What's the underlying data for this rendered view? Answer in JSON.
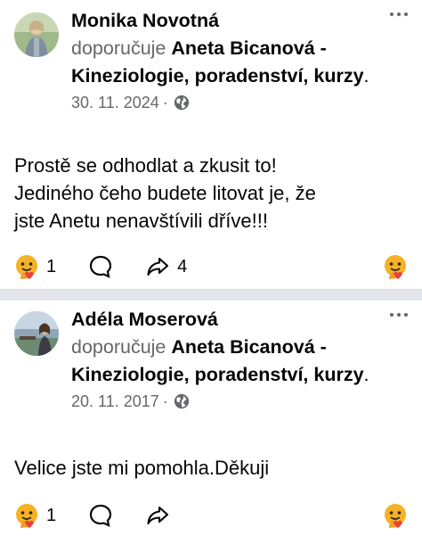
{
  "posts": [
    {
      "author": "Monika Novotná",
      "action": "doporučuje",
      "page": "Aneta Bicanová - Kineziologie, poradenství, kurzy",
      "date": "30. 11. 2024",
      "date_sep": "·",
      "text_lines": [
        "Prostě se odhodlat a zkusit to!",
        "Jediného čeho budete litovat je, že",
        "jste Anetu nenavštívili dříve!!!"
      ],
      "reaction_count": "1",
      "share_count": "4",
      "icons": {
        "reaction": "care-emoji-icon",
        "comment": "comment-icon",
        "share": "share-icon",
        "more": "more-icon",
        "audience": "globe-icon"
      }
    },
    {
      "author": "Adéla Moserová",
      "action": "doporučuje",
      "page": "Aneta Bicanová - Kineziologie, poradenství, kurzy",
      "date": "20. 11. 2017",
      "date_sep": "·",
      "text_lines": [
        "Velice jste mi pomohla.Děkuji"
      ],
      "reaction_count": "1",
      "share_count": "",
      "icons": {
        "reaction": "care-emoji-icon",
        "comment": "comment-icon",
        "share": "share-icon",
        "more": "more-icon",
        "audience": "globe-icon"
      }
    }
  ],
  "colors": {
    "text": "#050505",
    "secondary": "#65676b",
    "separator": "#e4e6eb",
    "emoji_yellow": "#f7b125",
    "emoji_red": "#e9413d"
  }
}
